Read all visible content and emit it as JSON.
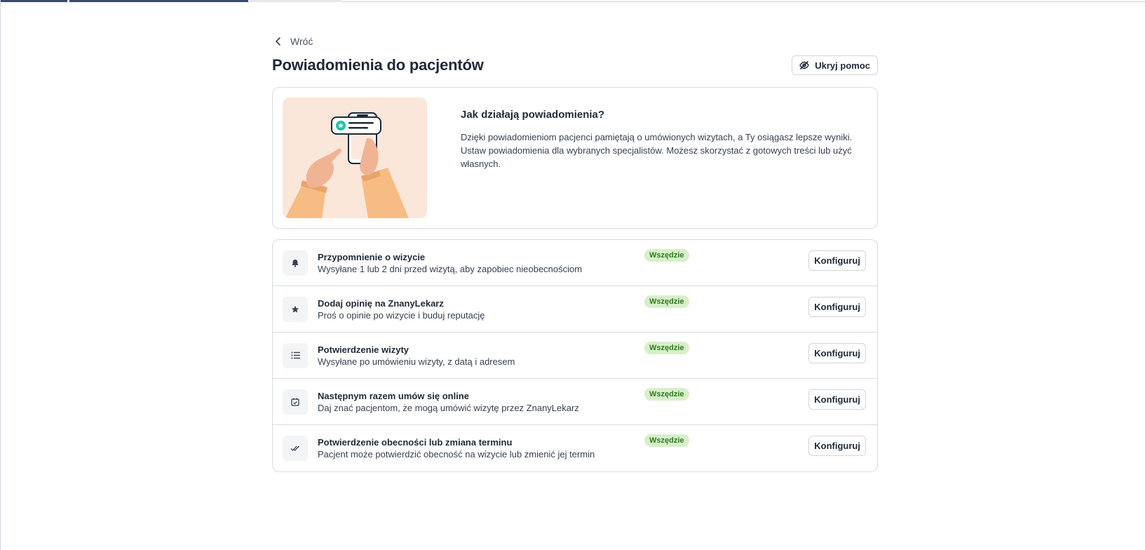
{
  "nav": {
    "back_label": "Wróć"
  },
  "page": {
    "title": "Powiadomienia do pacjentów",
    "hide_help_label": "Ukryj pomoc"
  },
  "help": {
    "title": "Jak działają powiadomienia?",
    "body": "Dzięki powiadomieniom pacjenci pamiętają o umówionych wizytach, a Ty osiągasz lepsze wyniki. Ustaw powiadomienia dla wybranych specjalistów. Możesz skorzystać z gotowych treści lub użyć własnych."
  },
  "notifications": [
    {
      "icon": "bell-icon",
      "title": "Przypomnienie o wizycie",
      "subtitle": "Wysyłane 1 lub 2 dni przed wizytą, aby zapobiec nieobecnościom",
      "badge": "Wszędzie",
      "action": "Konfiguruj"
    },
    {
      "icon": "star-icon",
      "title": "Dodaj opinię na ZnanyLekarz",
      "subtitle": "Proś o opinie po wizycie i buduj reputację",
      "badge": "Wszędzie",
      "action": "Konfiguruj"
    },
    {
      "icon": "list-icon",
      "title": "Potwierdzenie wizyty",
      "subtitle": "Wysyłane po umówieniu wizyty, z datą i adresem",
      "badge": "Wszędzie",
      "action": "Konfiguruj"
    },
    {
      "icon": "calendar-check-icon",
      "title": "Następnym razem umów się online",
      "subtitle": "Daj znać pacjentom, że mogą umówić wizytę przez ZnanyLekarz",
      "badge": "Wszędzie",
      "action": "Konfiguruj"
    },
    {
      "icon": "double-check-icon",
      "title": "Potwierdzenie obecności lub zmiana terminu",
      "subtitle": "Pacjent może potwierdzić obecność na wizycie lub zmienić jej termin",
      "badge": "Wszędzie",
      "action": "Konfiguruj"
    }
  ],
  "colors": {
    "badge_bg": "#d7f0c9",
    "badge_text": "#2f7a1f",
    "illustration_bg": "#fbe6da",
    "accent_teal": "#1fc4a6"
  }
}
